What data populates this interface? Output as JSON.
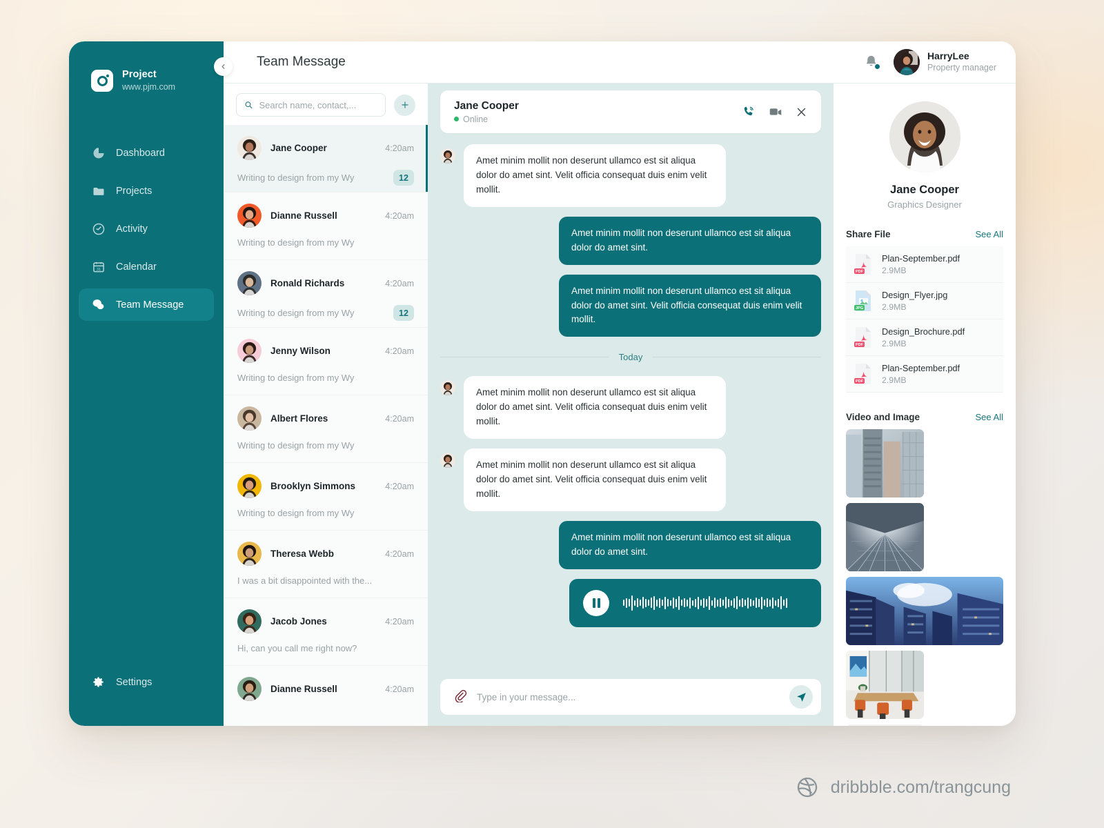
{
  "brand": {
    "name": "Project",
    "url": "www.pjm.com",
    "logo_icon": "camera-icon"
  },
  "sidebar": {
    "collapse_icon": "chevron-left-icon",
    "items": [
      {
        "label": "Dashboard",
        "icon": "pie-chart-icon",
        "active": false
      },
      {
        "label": "Projects",
        "icon": "folder-icon",
        "active": false
      },
      {
        "label": "Activity",
        "icon": "activity-target-icon",
        "active": false
      },
      {
        "label": "Calendar",
        "icon": "calendar-icon",
        "active": false
      },
      {
        "label": "Team Message",
        "icon": "chat-bubbles-icon",
        "active": true
      }
    ],
    "settings": {
      "label": "Settings",
      "icon": "gear-icon"
    }
  },
  "topbar": {
    "title": "Team Message",
    "bell_icon": "bell-icon",
    "user": {
      "name": "HarryLee",
      "role": "Property manager"
    }
  },
  "search": {
    "placeholder": "Search name, contact,...",
    "value": "",
    "icon": "search-icon"
  },
  "add_button": {
    "label": "+",
    "icon": "plus-icon"
  },
  "contacts": [
    {
      "name": "Jane Cooper",
      "time": "4:20am",
      "preview": "Writing to design from my Wy",
      "badge": "12",
      "selected": true
    },
    {
      "name": "Dianne Russell",
      "time": "4:20am",
      "preview": "Writing to design from my Wy",
      "badge": "",
      "selected": false
    },
    {
      "name": "Ronald Richards",
      "time": "4:20am",
      "preview": "Writing to design from my Wy",
      "badge": "12",
      "selected": false
    },
    {
      "name": "Jenny Wilson",
      "time": "4:20am",
      "preview": "Writing to design from my Wy",
      "badge": "",
      "selected": false
    },
    {
      "name": "Albert Flores",
      "time": "4:20am",
      "preview": "Writing to design from my Wy",
      "badge": "",
      "selected": false
    },
    {
      "name": "Brooklyn Simmons",
      "time": "4:20am",
      "preview": "Writing to design from my Wy",
      "badge": "",
      "selected": false
    },
    {
      "name": "Theresa Webb",
      "time": "4:20am",
      "preview": "I was a bit disappointed with the...",
      "badge": "",
      "selected": false
    },
    {
      "name": "Jacob Jones",
      "time": "4:20am",
      "preview": "Hi, can you call me right now?",
      "badge": "",
      "selected": false
    },
    {
      "name": "Dianne Russell",
      "time": "4:20am",
      "preview": "",
      "badge": "",
      "selected": false
    }
  ],
  "chat": {
    "header": {
      "name": "Jane Cooper",
      "status": "Online",
      "call_icon": "phone-icon",
      "video_icon": "video-camera-icon",
      "close_icon": "close-icon"
    },
    "day_separator": "Today",
    "messages": [
      {
        "dir": "in",
        "text": "Amet minim mollit non deserunt ullamco est sit aliqua dolor do amet sint. Velit officia consequat duis enim velit mollit."
      },
      {
        "dir": "out",
        "text": "Amet minim mollit non deserunt ullamco est sit aliqua dolor do amet sint."
      },
      {
        "dir": "out",
        "text": "Amet minim mollit non deserunt ullamco est sit aliqua dolor do amet sint. Velit officia consequat duis enim velit mollit."
      }
    ],
    "messages_today": [
      {
        "dir": "in",
        "text": "Amet minim mollit non deserunt ullamco est sit aliqua dolor do amet sint. Velit officia consequat duis enim velit mollit."
      },
      {
        "dir": "in",
        "text": "Amet minim mollit non deserunt ullamco est sit aliqua dolor do amet sint. Velit officia consequat duis enim velit mollit."
      },
      {
        "dir": "out",
        "text": "Amet minim mollit non deserunt ullamco est sit aliqua dolor do amet sint."
      }
    ],
    "audio_message": {
      "play_icon": "pause-icon",
      "waveform": "audio-waveform"
    },
    "composer": {
      "attach_icon": "paperclip-icon",
      "placeholder": "Type in your message...",
      "value": "",
      "send_icon": "send-icon"
    }
  },
  "right_panel": {
    "profile": {
      "name": "Jane Cooper",
      "role": "Graphics Designer"
    },
    "share_file": {
      "title": "Share File",
      "see_all": "See All",
      "files": [
        {
          "name": "Plan-September.pdf",
          "size": "2.9MB",
          "type": "PDF"
        },
        {
          "name": "Design_Flyer.jpg",
          "size": "2.9MB",
          "type": "JPG"
        },
        {
          "name": "Design_Brochure.pdf",
          "size": "2.9MB",
          "type": "PDF"
        },
        {
          "name": "Plan-September.pdf",
          "size": "2.9MB",
          "type": "PDF"
        }
      ]
    },
    "video_and_image": {
      "title": "Video and Image",
      "see_all": "See All",
      "tiles": [
        {
          "alt": "glass-office-towers",
          "span": "half"
        },
        {
          "alt": "skyward-glass-atrium",
          "span": "half"
        },
        {
          "alt": "blue-glass-skyscrapers",
          "span": "full"
        },
        {
          "alt": "meeting-room-interior",
          "span": "half"
        },
        {
          "alt": "open-plan-workspace",
          "span": "half"
        }
      ]
    }
  },
  "watermark": {
    "text": "dribbble.com/trangcung",
    "icon": "dribbble-icon"
  },
  "colors": {
    "brand_teal": "#0b7077",
    "sidebar_active": "#12818a",
    "chat_bg": "#dceae9",
    "badge_bg": "#cfe6e4",
    "badge_text": "#17757c",
    "online_green": "#2db56a",
    "accent_link": "#17757c"
  }
}
